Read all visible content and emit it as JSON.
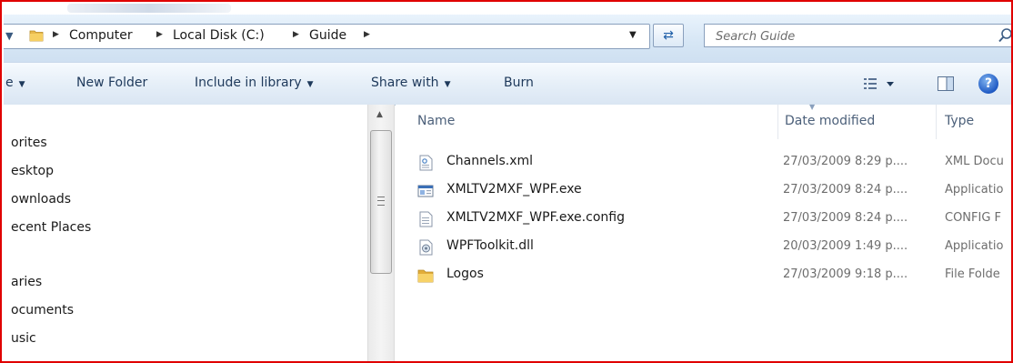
{
  "address_bar": {
    "breadcrumbs": [
      "Computer",
      "Local Disk (C:)",
      "Guide"
    ]
  },
  "search": {
    "placeholder": "Search Guide"
  },
  "toolbar": {
    "organize_label": "e",
    "new_folder_label": "New Folder",
    "include_library_label": "Include in library",
    "share_with_label": "Share with",
    "burn_label": "Burn"
  },
  "nav_pane": {
    "items": [
      "orites",
      "esktop",
      "ownloads",
      "ecent Places",
      "aries",
      "ocuments",
      "usic"
    ]
  },
  "file_list": {
    "headers": {
      "name": "Name",
      "date": "Date modified",
      "type": "Type"
    },
    "files": [
      {
        "name": "Channels.xml",
        "date": "27/03/2009 8:29 p....",
        "type": "XML Docu",
        "icon": "xml-file-icon"
      },
      {
        "name": "XMLTV2MXF_WPF.exe",
        "date": "27/03/2009 8:24 p....",
        "type": "Applicatio",
        "icon": "exe-file-icon"
      },
      {
        "name": "XMLTV2MXF_WPF.exe.config",
        "date": "27/03/2009 8:24 p....",
        "type": "CONFIG F",
        "icon": "config-file-icon"
      },
      {
        "name": "WPFToolkit.dll",
        "date": "20/03/2009 1:49 p....",
        "type": "Applicatio",
        "icon": "dll-file-icon"
      },
      {
        "name": "Logos",
        "date": "27/03/2009 9:18 p....",
        "type": "File Folde",
        "icon": "folder-icon"
      }
    ]
  },
  "colors": {
    "toolbar_text": "#1e395b",
    "frame_border": "#e00000",
    "secondary_text": "#6d6d6d"
  }
}
